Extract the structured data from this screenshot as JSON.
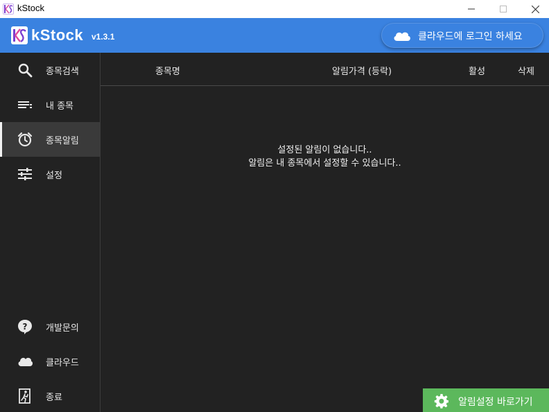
{
  "window": {
    "title": "kStock",
    "icon": "ks-app-icon",
    "controls": [
      "minimize",
      "maximize",
      "close"
    ]
  },
  "header": {
    "brand": "kStock",
    "version": "v1.3.1",
    "login_label": "클라우드에 로그인 하세요",
    "accent": "#3a82e0"
  },
  "sidebar": {
    "items": [
      {
        "label": "종목검색",
        "icon": "search-icon"
      },
      {
        "label": "내 종목",
        "icon": "list-icon"
      },
      {
        "label": "종목알림",
        "icon": "alarm-clock-icon",
        "active": true
      },
      {
        "label": "설정",
        "icon": "sliders-icon"
      }
    ],
    "bottom_items": [
      {
        "label": "개발문의",
        "icon": "help-icon"
      },
      {
        "label": "클라우드",
        "icon": "cloud-icon"
      },
      {
        "label": "종료",
        "icon": "exit-icon"
      }
    ]
  },
  "table": {
    "columns": [
      "종목명",
      "알림가격 (등락)",
      "활성",
      "삭제"
    ],
    "rows": []
  },
  "empty_state": {
    "line1": "설정된 알림이 없습니다..",
    "line2": "알림은 내 종목에서 설정할 수 있습니다.."
  },
  "fab": {
    "label": "알림설정 바로가기",
    "icon": "gear-icon",
    "color": "#5cb85c"
  }
}
